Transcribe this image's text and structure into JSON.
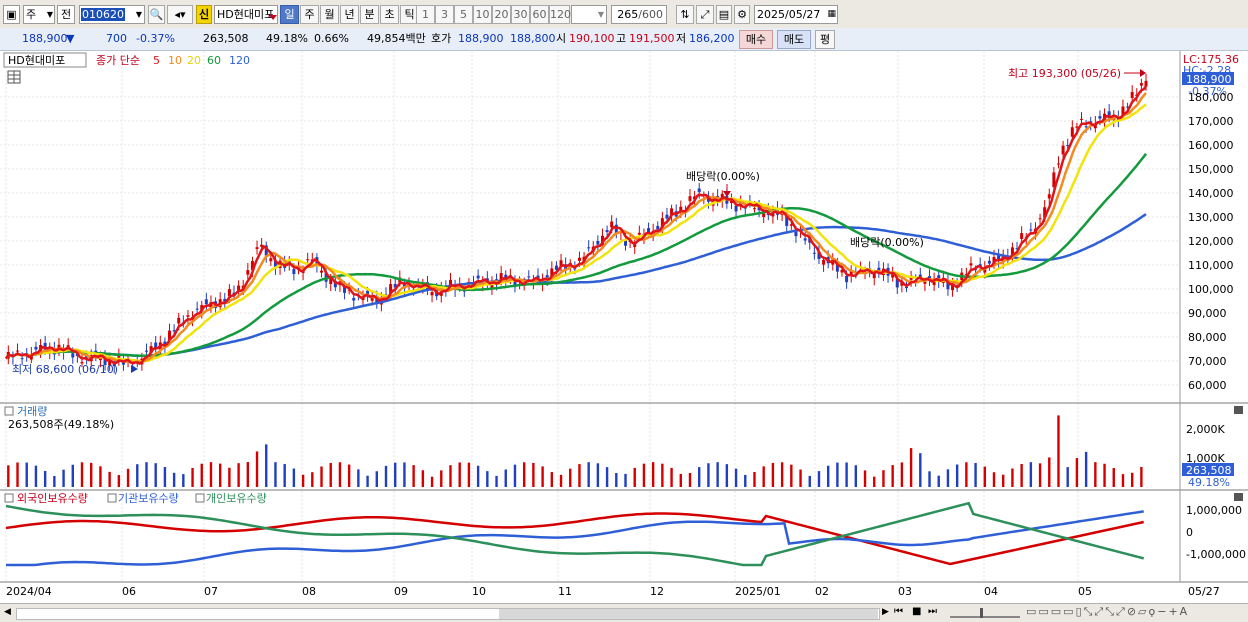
{
  "toolbar": {
    "market": "주",
    "type": "전",
    "code": "010620",
    "credit_badge": "신",
    "name": "HD현대미포",
    "periods": [
      "일",
      "주",
      "월",
      "년",
      "분",
      "초",
      "틱"
    ],
    "active_period": "일",
    "intervals": [
      "1",
      "3",
      "5",
      "10",
      "20",
      "30",
      "60",
      "120"
    ],
    "count": "265",
    "count_max": "/600",
    "date": "2025/05/27"
  },
  "quote": {
    "price": "188,900",
    "direction": "▼",
    "change": "700",
    "change_pct": "-0.37%",
    "volume": "263,508",
    "volume_pct": "49.18%",
    "turnover_pct": "0.66%",
    "amount": "49,854백만",
    "bid_label": "호가",
    "ask": "188,900",
    "bid": "188,800",
    "open_label": "시",
    "open": "190,100",
    "high_label": "고",
    "high": "191,500",
    "low_label": "저",
    "low": "186,200",
    "sell_button": "매수",
    "buy_button": "매도",
    "avg_button": "평"
  },
  "price_panel": {
    "stock_tag": "HD현대미포",
    "ma_title": "종가 단순",
    "ma_periods": [
      {
        "label": "5",
        "color": "#e0141b"
      },
      {
        "label": "10",
        "color": "#f28a1e"
      },
      {
        "label": "20",
        "color": "#f2e30a"
      },
      {
        "label": "60",
        "color": "#129a3c"
      },
      {
        "label": "120",
        "color": "#2f5fd6"
      }
    ],
    "lc": "LC:175.36",
    "hc": "HC:-2.28",
    "last_price": "188,900",
    "last_change": "-0.37%",
    "y_ticks": [
      "180,000",
      "170,000",
      "160,000",
      "150,000",
      "140,000",
      "130,000",
      "120,000",
      "110,000",
      "100,000",
      "90,000",
      "80,000",
      "70,000",
      "60,000"
    ],
    "high_annotation": "최고 193,300 (05/26)",
    "low_annotation": "최저 68,600 (06/10)",
    "dividend_1": "배당락(0.00%)",
    "dividend_2": "배당락(0.00%)"
  },
  "volume_panel": {
    "title": "거래량",
    "value": "263,508주(49.18%)",
    "y_ticks": [
      "2,000K",
      "1,000K"
    ],
    "last_value": "263,508",
    "last_pct": "49.18%"
  },
  "holdings_panel": {
    "legend": [
      "외국인보유수량",
      "기관보유수량",
      "개인보유수량"
    ],
    "y_ticks": [
      "1,000,000",
      "0",
      "-1,000,000"
    ]
  },
  "x_axis": {
    "labels": [
      "2024/04",
      "06",
      "07",
      "08",
      "09",
      "10",
      "11",
      "12",
      "2025/01",
      "02",
      "03",
      "04",
      "05"
    ],
    "right_label": "05/27"
  },
  "colors": {
    "ma5": "#e0141b",
    "ma10": "#f28a1e",
    "ma20": "#f2e30a",
    "ma60": "#129a3c",
    "ma120": "#2f5fd6",
    "up": "#d40000",
    "down": "#1f3fbf",
    "foreign": "#d40000",
    "institution": "#2f5fd6",
    "individual": "#2d8f5a"
  },
  "chart_data": {
    "type": "line",
    "title": "HD현대미포",
    "price_series": [
      {
        "name": "5",
        "x": [
          "2024/04",
          "2024/05",
          "2024/06",
          "2024/07",
          "2024/08",
          "2024/09",
          "2024/10",
          "2024/11",
          "2024/12",
          "2025/01",
          "2025/02",
          "2025/03",
          "2025/04",
          "2025/05"
        ],
        "values": [
          71000,
          76000,
          70000,
          92000,
          108000,
          97000,
          103000,
          105000,
          128000,
          136000,
          112000,
          105000,
          120000,
          188900
        ]
      },
      {
        "name": "60",
        "x": [
          "2024/04",
          "2024/06",
          "2024/08",
          "2024/10",
          "2024/12",
          "2025/02",
          "2025/04",
          "2025/05"
        ],
        "values": [
          64000,
          68000,
          85000,
          103000,
          108000,
          127000,
          113000,
          134000
        ]
      },
      {
        "name": "120",
        "x": [
          "2024/04",
          "2024/06",
          "2024/08",
          "2024/10",
          "2024/12",
          "2025/02",
          "2025/04",
          "2025/05"
        ],
        "values": [
          64000,
          69000,
          76000,
          90000,
          105000,
          115000,
          116000,
          129000
        ]
      }
    ],
    "ylim": [
      55000,
      195000
    ],
    "volume": {
      "ylim": [
        0,
        2600000
      ],
      "max_value": 2450000,
      "last": 263508
    },
    "holdings": {
      "ylim": [
        -1700000,
        1700000
      ]
    }
  }
}
